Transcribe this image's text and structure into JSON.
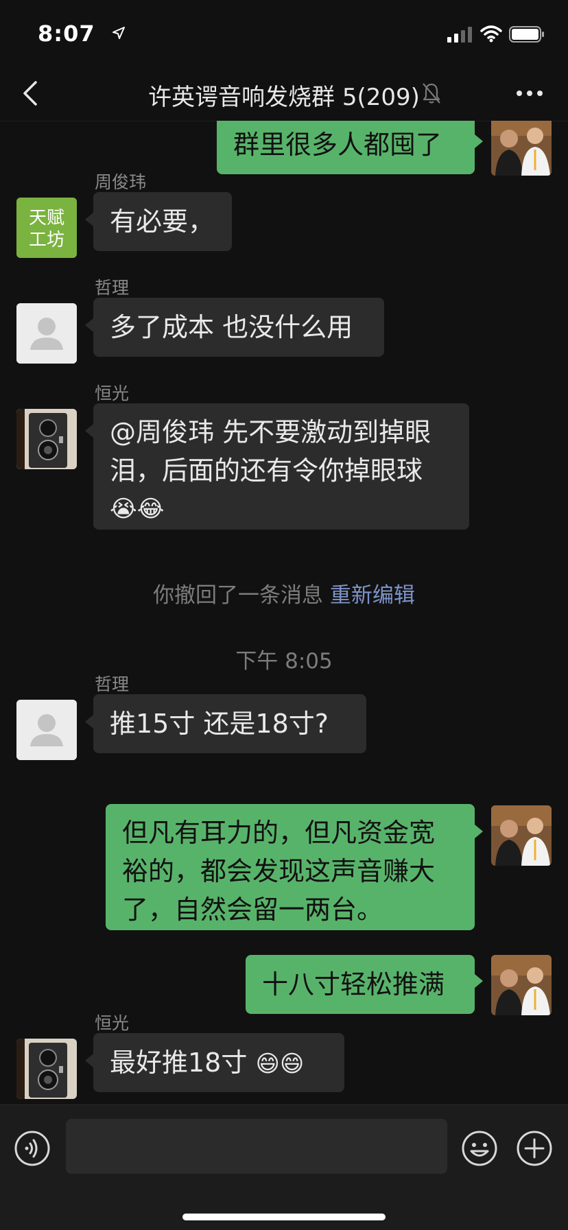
{
  "status_bar": {
    "time": "8:07"
  },
  "header": {
    "title": "许英谔音响发烧群 5(209)"
  },
  "messages": [
    {
      "text": "群里很多人都囤了"
    },
    {
      "sender": "周俊玮",
      "avatar_text_line1": "天赋",
      "avatar_text_line2": "工坊",
      "text": "有必要，"
    },
    {
      "sender": "哲理",
      "text": "多了成本 也没什么用"
    },
    {
      "sender": "恒光",
      "text_line1": "@周俊玮 先不要激动到掉眼",
      "text_line2": "泪，后面的还有令你掉眼球",
      "emoji_line3": "😭😂"
    },
    {
      "sender": "哲理",
      "text": "推15寸 还是18寸?"
    },
    {
      "text_line1": "但凡有耳力的，但凡资金宽",
      "text_line2": "裕的，都会发现这声音赚大",
      "text_line3": "了，自然会留一两台。"
    },
    {
      "text": "十八寸轻松推满"
    },
    {
      "sender": "恒光",
      "text": "最好推18寸",
      "emoji": "😄😄"
    }
  ],
  "system": {
    "recall_text": "你撤回了一条消息",
    "recall_link": "重新编辑",
    "timestamp": "下午 8:05"
  },
  "input_bar": {
    "placeholder": ""
  },
  "icons": {
    "location": "location-arrow-icon",
    "signal": "cellular-signal-icon",
    "wifi": "wifi-icon",
    "battery": "battery-icon",
    "back": "chevron-left-icon",
    "mute": "bell-muted-icon",
    "more": "more-dots-icon",
    "voice": "voice-input-icon",
    "emoji": "emoji-icon",
    "plus": "plus-icon"
  },
  "colors": {
    "background": "#111111",
    "incoming_bubble": "#2c2c2c",
    "outgoing_bubble": "#58b36a",
    "link": "#7d93c9"
  }
}
